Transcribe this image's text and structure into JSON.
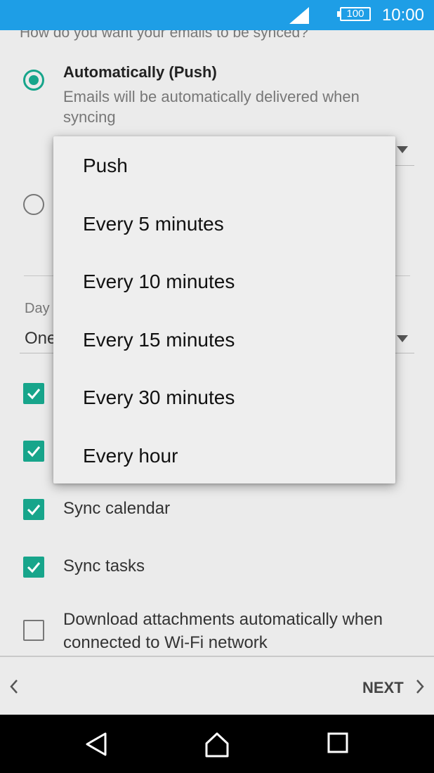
{
  "status_bar": {
    "battery": "100",
    "time": "10:00",
    "signal_icon": "signal-icon"
  },
  "sync_section": {
    "question": "How do you want your emails to be synced?",
    "option_auto": {
      "title": "Automatically (Push)",
      "description": "Emails will be automatically delivered when syncing",
      "selected": true
    },
    "option_manual": {
      "selected": false
    }
  },
  "days_field": {
    "label": "Day",
    "value": "One"
  },
  "checkboxes": [
    {
      "label": "",
      "checked": true
    },
    {
      "label": "",
      "checked": true
    },
    {
      "label": "Sync calendar",
      "checked": true
    },
    {
      "label": "Sync tasks",
      "checked": true
    },
    {
      "label": "Download attachments automatically when connected to Wi-Fi network",
      "checked": false
    }
  ],
  "sync_frequency_menu": {
    "items": [
      "Push",
      "Every 5 minutes",
      "Every 10 minutes",
      "Every 15 minutes",
      "Every 30 minutes",
      "Every hour"
    ]
  },
  "bottom_bar": {
    "next_label": "NEXT"
  },
  "colors": {
    "status_bar": "#1e9ee6",
    "accent": "#17a58b"
  }
}
